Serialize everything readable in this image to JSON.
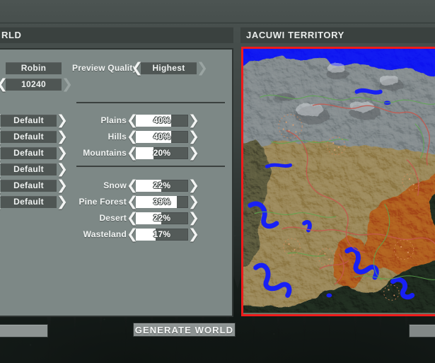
{
  "window": {
    "background_color": "#2b2f2e"
  },
  "headers": {
    "left_title": "RLD",
    "right_title": "JACUWI TERRITORY"
  },
  "world_panel": {
    "world_name": {
      "value": "Robin",
      "name_label": "world-name-field"
    },
    "world_size": {
      "value": "10240",
      "prev_arrow": "❮",
      "next_arrow": "❯"
    },
    "preview_quality": {
      "label": "Preview Quality",
      "value": "Highest",
      "prev_arrow": "❮",
      "next_arrow": "❯",
      "next_disabled": true
    },
    "dropdowns": [
      {
        "value": "Default"
      },
      {
        "value": "Default"
      },
      {
        "value": "Default"
      },
      {
        "value": "Default"
      },
      {
        "value": "Default"
      },
      {
        "value": "Default"
      }
    ],
    "terrain_sliders": [
      {
        "label": "Plains",
        "value": "40%",
        "fill_percent": 68
      },
      {
        "label": "Hills",
        "value": "40%",
        "fill_percent": 68
      },
      {
        "label": "Mountains",
        "value": "20%",
        "fill_percent": 34
      }
    ],
    "biome_sliders": [
      {
        "label": "Snow",
        "value": "22%",
        "fill_percent": 49
      },
      {
        "label": "Pine Forest",
        "value": "39%",
        "fill_percent": 78
      },
      {
        "label": "Desert",
        "value": "22%",
        "fill_percent": 49
      },
      {
        "label": "Wasteland",
        "value": "17%",
        "fill_percent": 38
      }
    ]
  },
  "map_preview": {
    "border_color": "#f01b1b",
    "legend_colors": {
      "water": "#1820f5",
      "snow": "#9ea4a6",
      "plains": "#b0a179",
      "desert": "#c1802a",
      "pine_forest": "#2c3a2b",
      "road": "#c4594f",
      "trail": "#5ca84e"
    }
  },
  "buttons": {
    "generate_world": "GENERATE WORLD",
    "back": "",
    "next": ""
  }
}
